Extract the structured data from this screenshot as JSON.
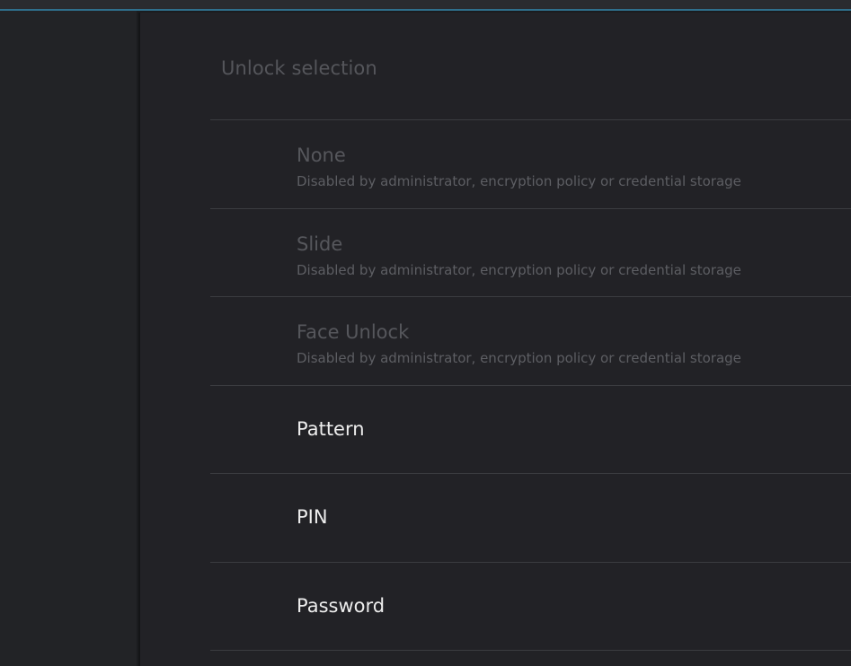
{
  "dialog": {
    "title": "Unlock selection"
  },
  "items": [
    {
      "label": "None",
      "summary": "Disabled by administrator, encryption policy or credential storage",
      "enabled": false
    },
    {
      "label": "Slide",
      "summary": "Disabled by administrator, encryption policy or credential storage",
      "enabled": false
    },
    {
      "label": "Face Unlock",
      "summary": "Disabled by administrator, encryption policy or credential storage",
      "enabled": false
    },
    {
      "label": "Pattern",
      "enabled": true
    },
    {
      "label": "PIN",
      "enabled": true
    },
    {
      "label": "Password",
      "enabled": true
    }
  ],
  "colors": {
    "background": "#1b1c1f",
    "panel": "#222226",
    "accent": "#2f6f8c",
    "disabled_text": "#56575c",
    "enabled_text": "#ededed"
  }
}
